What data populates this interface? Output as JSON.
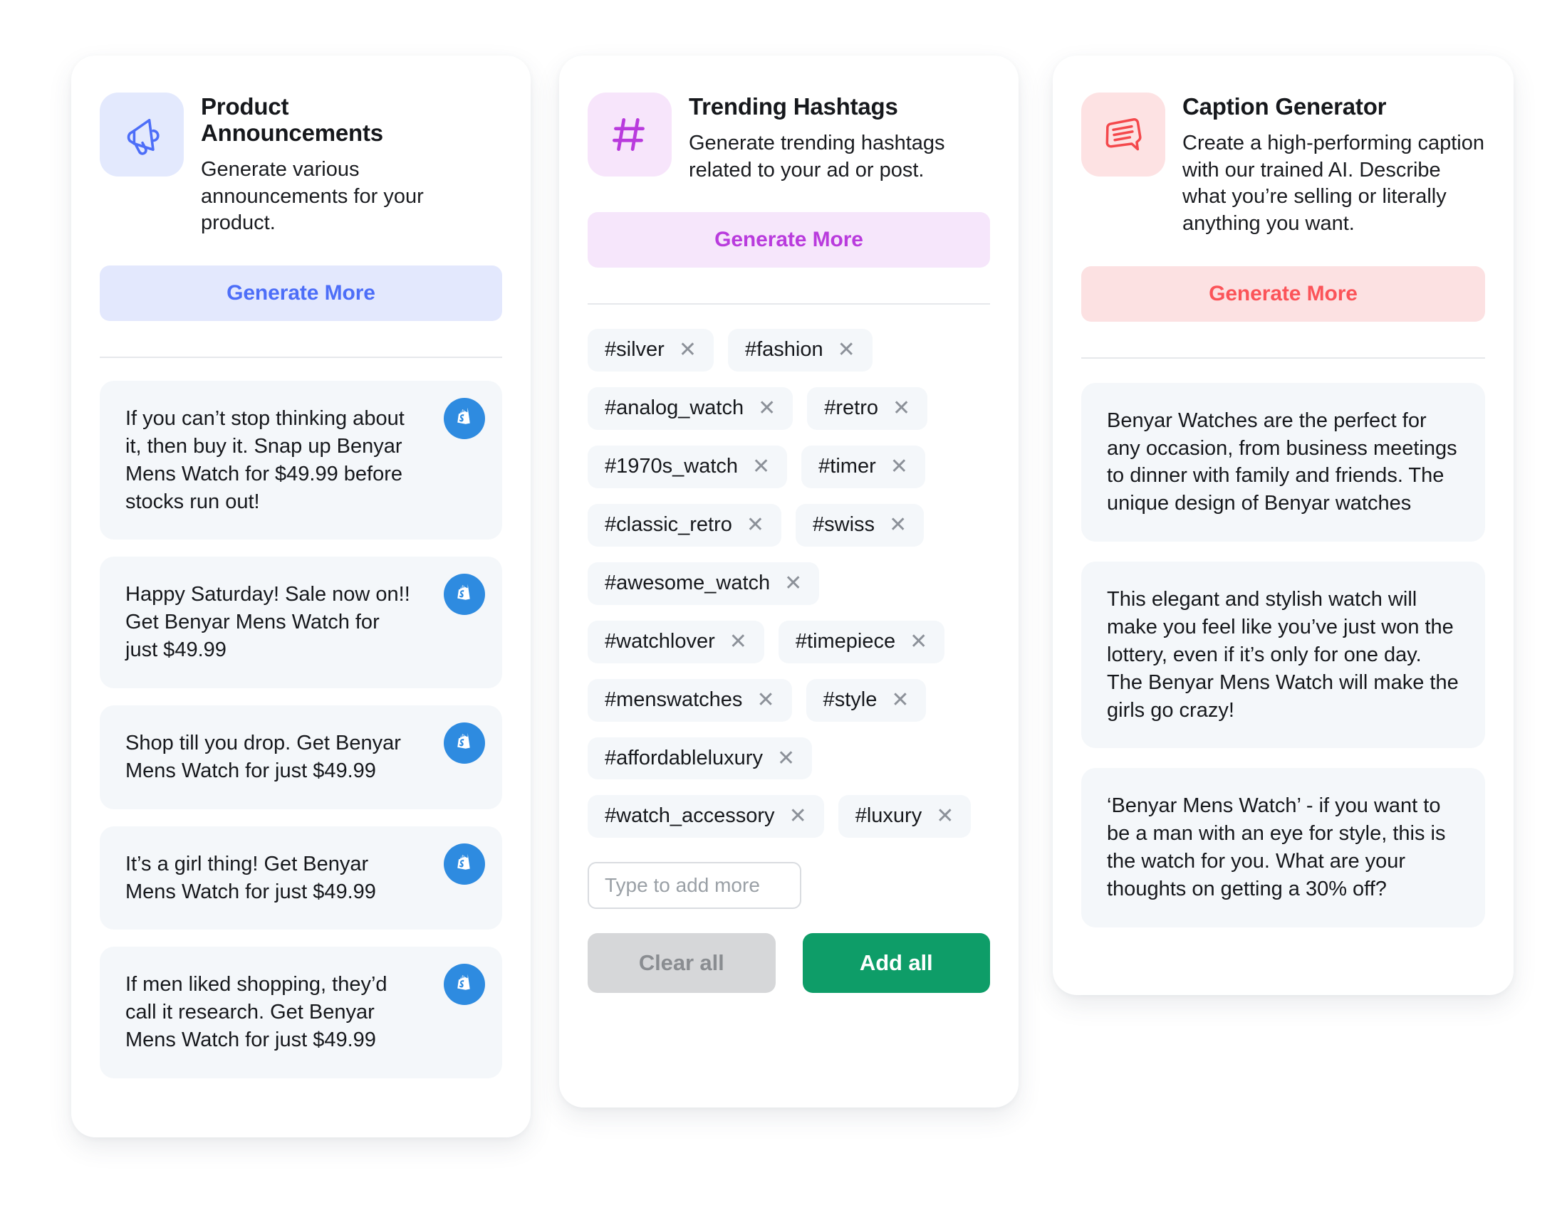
{
  "colors": {
    "page_background": "#FFFFFF",
    "card_background": "#FFFFFF",
    "content_box_background": "#F4F7FA",
    "accent_blue": "#4D6EF8",
    "accent_purple": "#B93BDD",
    "accent_red": "#FB5459",
    "shopify_blue": "#2E8BE0",
    "add_all_green": "#0E9D68",
    "clear_all_grey": "#D6D7D9",
    "divider": "#E6E8EB"
  },
  "cards": {
    "announcements": {
      "icon": "megaphone-icon",
      "title": "Product Announcements",
      "description": "Generate various announcements for your product.",
      "generate_label": "Generate More",
      "items": [
        {
          "text": "If you can’t stop thinking about it, then buy it. Snap up Benyar Mens Watch for $49.99 before stocks run out!",
          "badge": "shopify-icon"
        },
        {
          "text": "Happy Saturday! Sale now on!! Get Benyar Mens Watch for just $49.99",
          "badge": "shopify-icon"
        },
        {
          "text": "Shop till you drop. Get Benyar Mens Watch for just $49.99",
          "badge": "shopify-icon"
        },
        {
          "text": "It’s a girl thing! Get Benyar Mens Watch for just $49.99",
          "badge": "shopify-icon"
        },
        {
          "text": "If men liked shopping, they’d call it research. Get Benyar Mens Watch for just $49.99",
          "badge": "shopify-icon"
        }
      ]
    },
    "hashtags": {
      "icon": "hash-icon",
      "title": "Trending Hashtags",
      "description": "Generate trending hashtags related to your ad or post.",
      "generate_label": "Generate More",
      "remove_icon": "close-icon",
      "tags": [
        "#silver",
        "#fashion",
        "#analog_watch",
        "#retro",
        "#1970s_watch",
        "#timer",
        "#classic_retro",
        "#swiss",
        "#awesome_watch",
        "#watchlover",
        "#timepiece",
        "#menswatches",
        "#style",
        "#affordableluxury",
        "#watch_accessory",
        "#luxury"
      ],
      "input": {
        "value": "",
        "placeholder": "Type to add more"
      },
      "clear_all_label": "Clear all",
      "add_all_label": "Add all"
    },
    "caption": {
      "icon": "speech-bubble-icon",
      "title": "Caption Generator",
      "description": "Create a high-performing caption with our trained AI. Describe what you’re selling or literally anything you want.",
      "generate_label": "Generate More",
      "items": [
        {
          "text": "Benyar Watches are the perfect for any occasion, from business meetings to dinner with family and friends. The unique design of Benyar watches"
        },
        {
          "text": "This elegant and stylish watch will make you feel like you’ve just won the lottery, even if it’s only for one day. The Benyar Mens Watch will make the girls go crazy!"
        },
        {
          "text": "‘Benyar Mens Watch’ - if you want to be a man with an eye for style, this is the watch for you. What are your thoughts on getting a 30% off?"
        }
      ]
    }
  }
}
